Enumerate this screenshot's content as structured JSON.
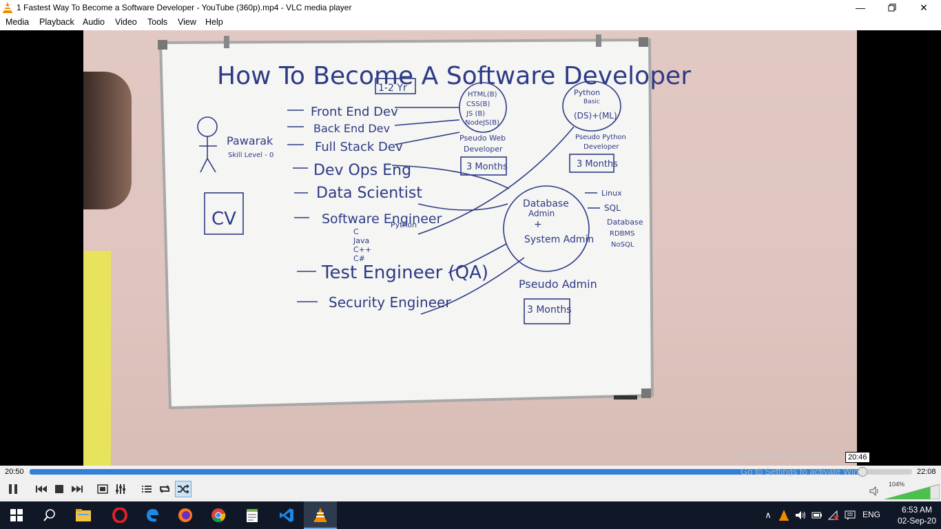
{
  "window": {
    "title": "1 Fastest Way To Become a Software Developer - YouTube (360p).mp4 - VLC media player",
    "minimize_icon": "minimize-icon",
    "maximize_icon": "restore-icon",
    "close_icon": "close-icon"
  },
  "menu": {
    "items": [
      "Media",
      "Playback",
      "Audio",
      "Video",
      "Tools",
      "View",
      "Help"
    ]
  },
  "whiteboard": {
    "title": "How To Become A Software Developer",
    "duration_note": "1-2 Yr",
    "roles": [
      "Front End Dev",
      "Back End Dev",
      "Full Stack Dev",
      "Dev Ops Eng",
      "Data Scientist",
      "Software Engineer",
      "Test Engineer (QA)",
      "Security Engineer"
    ],
    "langs": [
      "C",
      "Java",
      "C++",
      "C#",
      "Python"
    ],
    "web_bubble": [
      "HTML(B)",
      "CSS(B)",
      "JS (B)",
      "NodeJS(B)"
    ],
    "web_label": [
      "Pseudo Web",
      "Developer"
    ],
    "web_months": "3 Months",
    "py_bubble": [
      "Python",
      "Basic",
      "(DS)+(ML)"
    ],
    "py_label": [
      "Pseudo Python",
      "Developer"
    ],
    "py_months": "3 Months",
    "db_bubble": [
      "Database",
      "Admin",
      "+",
      "System Admin"
    ],
    "db_list": [
      "Linux",
      "SQL",
      "Database",
      "RDBMS",
      "NoSQL"
    ],
    "db_label": "Pseudo Admin",
    "db_months": "3 Months",
    "person_name": "Pawarak",
    "person_sub": "Skill Level - 0",
    "cv": "CV"
  },
  "playback": {
    "elapsed": "20:50",
    "total": "22:08",
    "hover_time": "20:46",
    "progress": 0.943,
    "volume_pct": "104%",
    "volume": 1.04
  },
  "watermark": {
    "line1": "Activate Windows",
    "line2": "Go to Settings to activate Windows."
  },
  "controls": {
    "pause": "pause-icon",
    "prev": "previous-icon",
    "stop": "stop-icon",
    "next": "next-icon",
    "fullscreen": "fullscreen-icon",
    "extended": "extended-settings-icon",
    "playlist": "playlist-icon",
    "loop": "loop-icon",
    "random": "shuffle-icon",
    "mute": "speaker-icon"
  },
  "taskbar": {
    "apps": [
      "start-icon",
      "search-icon",
      "file-explorer-icon",
      "opera-icon",
      "edge-icon",
      "firefox-icon",
      "chrome-icon",
      "notepad-icon",
      "vscode-icon",
      "vlc-icon"
    ],
    "lang": "ENG",
    "time": "6:53 AM",
    "date": "02-Sep-20"
  },
  "colors": {
    "seek_fill": "#2f80d6",
    "taskbar": "#101827",
    "vlc_orange": "#f08a00"
  }
}
